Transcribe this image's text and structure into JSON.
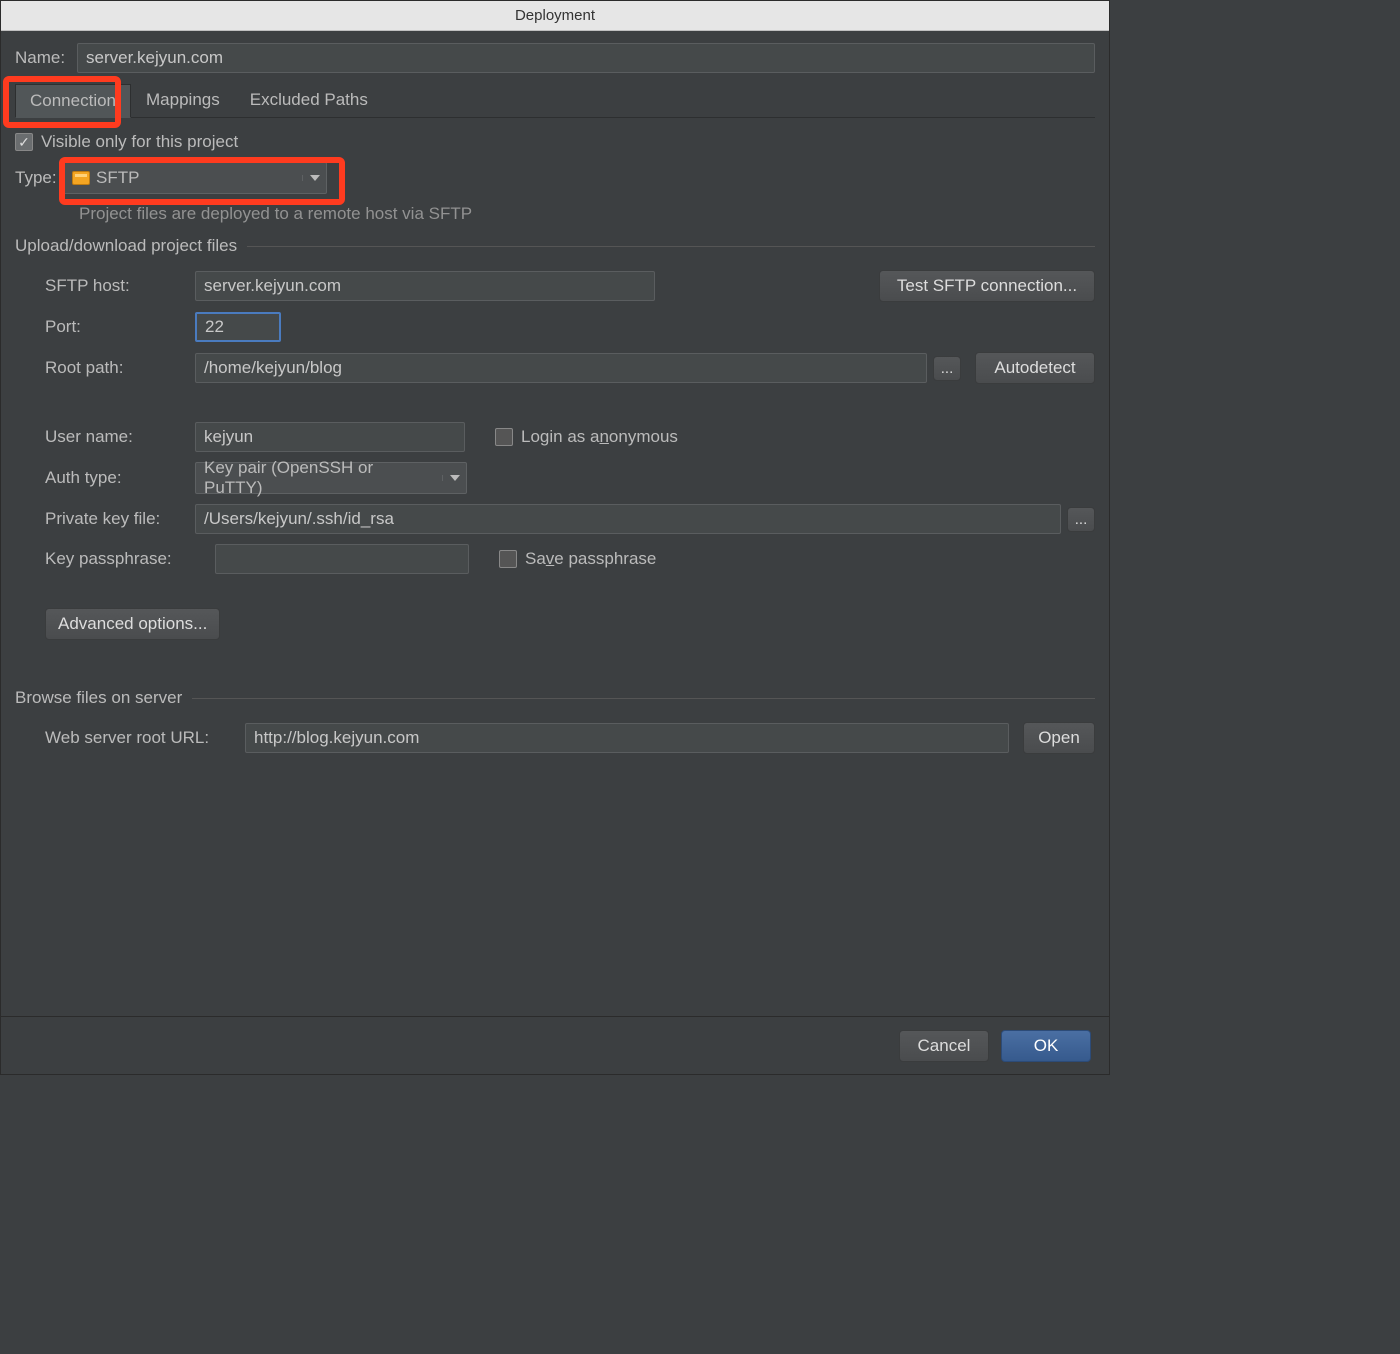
{
  "window": {
    "title": "Deployment"
  },
  "name": {
    "label": "Name:",
    "value": "server.kejyun.com"
  },
  "tabs": {
    "connection": "Connection",
    "mappings": "Mappings",
    "excluded": "Excluded Paths"
  },
  "visible_checkbox": {
    "label": "Visible only for this project",
    "checked": true
  },
  "type": {
    "label": "Type:",
    "selected": "SFTP",
    "hint": "Project files are deployed to a remote host via SFTP"
  },
  "sections": {
    "upload": "Upload/download project files",
    "browse": "Browse files on server"
  },
  "fields": {
    "sftp_host": {
      "label": "SFTP host:",
      "value": "server.kejyun.com"
    },
    "test_btn": "Test SFTP connection...",
    "port": {
      "label": "Port:",
      "value": "22"
    },
    "root_path": {
      "label": "Root path:",
      "value": "/home/kejyun/blog"
    },
    "browse_btn": "...",
    "autodetect_btn": "Autodetect",
    "user_name": {
      "label": "User name:",
      "value": "kejyun"
    },
    "login_anon": {
      "label_prefix": "Login as a",
      "label_u": "n",
      "label_suffix": "onymous",
      "checked": false
    },
    "auth_type": {
      "label": "Auth type:",
      "value": "Key pair (OpenSSH or PuTTY)"
    },
    "private_key": {
      "label": "Private key file:",
      "value": "/Users/kejyun/.ssh/id_rsa"
    },
    "key_pass": {
      "label": "Key passphrase:",
      "value": ""
    },
    "save_pass": {
      "label_prefix": "Sa",
      "label_u": "v",
      "label_suffix": "e passphrase",
      "checked": false
    },
    "advanced_btn": "Advanced options...",
    "web_root": {
      "label": "Web server root URL:",
      "value": "http://blog.kejyun.com"
    },
    "open_btn": "Open"
  },
  "footer": {
    "cancel": "Cancel",
    "ok": "OK"
  }
}
